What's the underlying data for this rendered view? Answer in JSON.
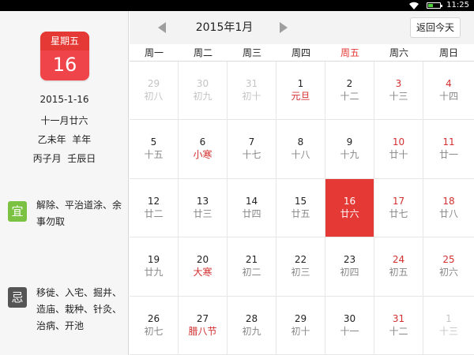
{
  "statusbar": {
    "time": "11:25"
  },
  "colors": {
    "accent": "#e53935",
    "yi": "#7cc242",
    "ji": "#555555",
    "festival": "#d32f2f"
  },
  "left": {
    "weekday": "星期五",
    "day": "16",
    "date": "2015-1-16",
    "lunar": "十一月廿六",
    "ganzhi_year": "乙未年  羊年",
    "ganzhi_month": "丙子月  壬辰日",
    "yi_label": "宜",
    "yi_text": "解除、平治道涂、余事勿取",
    "ji_label": "忌",
    "ji_text": "移徙、入宅、掘井、造庙、栽种、针灸、治病、开池"
  },
  "header": {
    "month_title": "2015年1月",
    "today_button": "返回今天",
    "prev_icon": "arrow-left-icon",
    "next_icon": "arrow-right-icon"
  },
  "weekdays": [
    "周一",
    "周二",
    "周三",
    "周四",
    "周五",
    "周六",
    "周日"
  ],
  "days": [
    {
      "n": "29",
      "l": "初八",
      "other": true
    },
    {
      "n": "30",
      "l": "初九",
      "other": true
    },
    {
      "n": "31",
      "l": "初十",
      "other": true
    },
    {
      "n": "1",
      "l": "元旦",
      "fest": true
    },
    {
      "n": "2",
      "l": "十二"
    },
    {
      "n": "3",
      "l": "十三",
      "weekend": true
    },
    {
      "n": "4",
      "l": "十四",
      "weekend": true
    },
    {
      "n": "5",
      "l": "十五"
    },
    {
      "n": "6",
      "l": "小寒",
      "fest": true
    },
    {
      "n": "7",
      "l": "十七"
    },
    {
      "n": "8",
      "l": "十八"
    },
    {
      "n": "9",
      "l": "十九"
    },
    {
      "n": "10",
      "l": "廿十",
      "weekend": true
    },
    {
      "n": "11",
      "l": "廿一",
      "weekend": true
    },
    {
      "n": "12",
      "l": "廿二"
    },
    {
      "n": "13",
      "l": "廿三"
    },
    {
      "n": "14",
      "l": "廿四"
    },
    {
      "n": "15",
      "l": "廿五"
    },
    {
      "n": "16",
      "l": "廿六",
      "selected": true
    },
    {
      "n": "17",
      "l": "廿七",
      "weekend": true
    },
    {
      "n": "18",
      "l": "廿八",
      "weekend": true
    },
    {
      "n": "19",
      "l": "廿九"
    },
    {
      "n": "20",
      "l": "大寒",
      "fest": true
    },
    {
      "n": "21",
      "l": "初二"
    },
    {
      "n": "22",
      "l": "初三"
    },
    {
      "n": "23",
      "l": "初四"
    },
    {
      "n": "24",
      "l": "初五",
      "weekend": true
    },
    {
      "n": "25",
      "l": "初六",
      "weekend": true
    },
    {
      "n": "26",
      "l": "初七"
    },
    {
      "n": "27",
      "l": "腊八节",
      "fest": true
    },
    {
      "n": "28",
      "l": "初九"
    },
    {
      "n": "29",
      "l": "初十"
    },
    {
      "n": "30",
      "l": "十一"
    },
    {
      "n": "31",
      "l": "十二",
      "weekend": true
    },
    {
      "n": "1",
      "l": "十三",
      "other": true
    }
  ]
}
